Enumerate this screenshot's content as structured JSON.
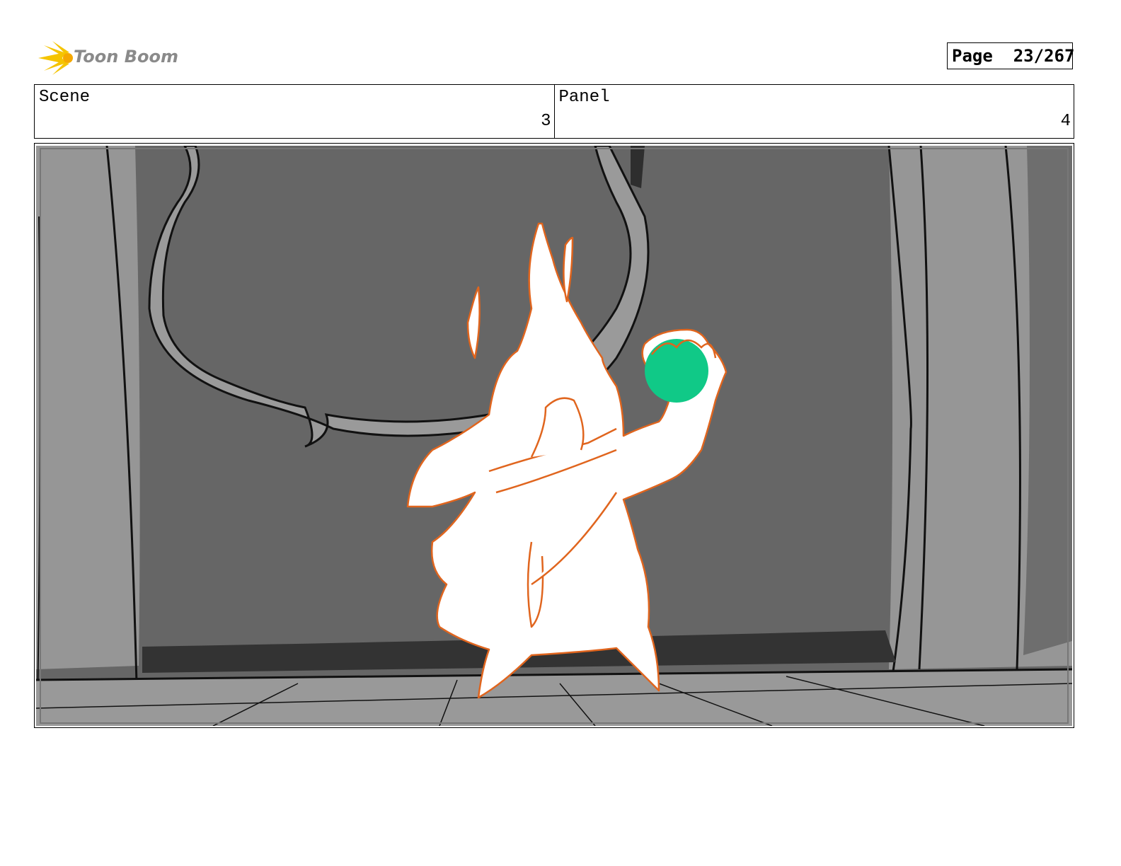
{
  "brand": {
    "name": "Toon Boom",
    "logo": "starburst-logo-icon"
  },
  "page": {
    "label": "Page",
    "current": 23,
    "total": 267,
    "display": "Page  23/267"
  },
  "scene": {
    "label": "Scene",
    "value": "3"
  },
  "panel": {
    "label": "Panel",
    "value": "4"
  },
  "drawing": {
    "description_icons": [
      "storyboard-sketch"
    ],
    "colors": {
      "wall": "#666666",
      "pillar": "#969696",
      "floor": "#999999",
      "shadow": "#333333",
      "character_outline": "#e0651e",
      "orb": "#10c987"
    }
  }
}
